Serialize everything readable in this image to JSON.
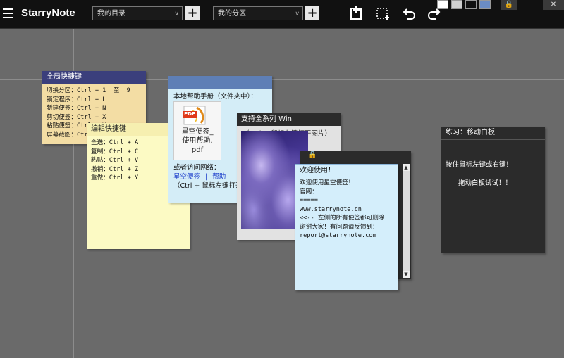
{
  "toolbar": {
    "app_title": "StarryNote",
    "directory_select": "我的目录",
    "section_select": "我的分区",
    "add_symbol": "+",
    "lock_symbol": "🔒",
    "close_symbol": "✕",
    "icons": [
      "menu-icon",
      "new-note-icon",
      "region-select-icon",
      "undo-icon",
      "redo-icon"
    ],
    "swatches": [
      "#ffffff",
      "#d0d0d0",
      "#111111",
      "#6b8cc4"
    ]
  },
  "notes": {
    "global": {
      "title": "全局快捷键",
      "lines": [
        "切换分区：Ctrl + 1  至  9",
        "锁定程序：Ctrl + L",
        "新建便签：Ctrl + N",
        "剪切便签：Ctrl + X",
        "粘贴便签：Ctrl + V",
        "屏幕截图：Ctrl + Q"
      ],
      "colors": {
        "title_bg": "#3b3f7c",
        "title_fg": "#ffffff",
        "body_bg": "#f3dda4"
      }
    },
    "edit": {
      "title": "编辑快捷键",
      "lines": [
        "全选：Ctrl + A",
        "复制：Ctrl + C",
        "粘贴：Ctrl + V",
        "撤销：Ctrl + Z",
        "重做：Ctrl + Y"
      ],
      "colors": {
        "title_bg": "#f6efb0",
        "body_bg": "#fcfac4"
      }
    },
    "help": {
      "intro": "本地帮助手册（文件夹中）：",
      "pdf_badge": "PDF",
      "pdf_name_1": "星空便签_",
      "pdf_name_2": "使用帮助.",
      "pdf_name_3": "pdf",
      "or_visit": "或者访问网络：",
      "link_site": "星空便签",
      "sep": "|",
      "link_help": "帮助",
      "hint": "（Ctrl + 鼠标左键打开",
      "colors": {
        "title_bg": "#5e7fb6",
        "body_bg": "#d4edf7"
      }
    },
    "image": {
      "title": "支持全系列 Win",
      "hint": "（Ctrl + 鼠标左键打开图片）",
      "colors": {
        "title_bg": "#2b2b2b",
        "body_bg": "#e2e2e2"
      }
    },
    "welcome": {
      "title": "欢迎使用！",
      "lines": [
        "欢迎使用星空便签！",
        "",
        "官网：",
        "=====",
        "www.starrynote.cn",
        "",
        "<<-- 左侧的所有便签都可删除",
        "",
        "谢谢大家！有问题请反馈到：",
        "report@starrynote.com"
      ],
      "colors": {
        "body_bg": "#d4eefb",
        "border": "#8ab4d8"
      }
    },
    "whiteboard": {
      "title": "练习：移动白板",
      "line1": "按住鼠标左键或右键！",
      "line2": "拖动白板试试！！",
      "colors": {
        "bg": "#2b2b2b",
        "fg": "#ffffff"
      }
    }
  }
}
